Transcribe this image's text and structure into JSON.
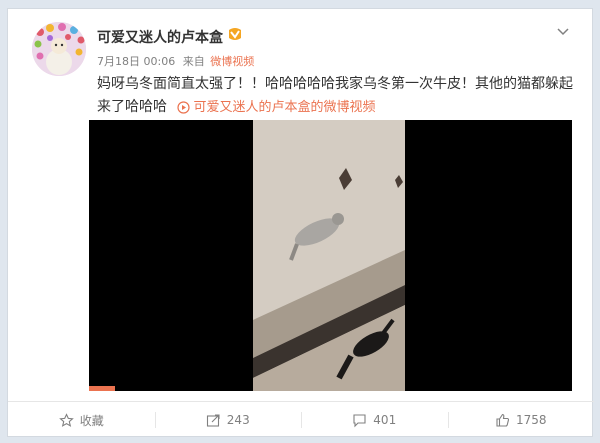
{
  "post": {
    "username": "可爱又迷人的卢本盒",
    "date": "7月18日 00:06",
    "source_prefix": "来自",
    "source_name": "微博视频",
    "text": "妈呀乌冬面简直太强了！！哈哈哈哈哈我家乌冬第一次牛皮！其他的猫都躲起来了哈哈哈",
    "video_link": "可爱又迷人的卢本盒的微博视频"
  },
  "actions": {
    "favorite_label": "收藏",
    "repost_count": "243",
    "comment_count": "401",
    "like_count": "1758"
  },
  "colors": {
    "accent": "#eb7350",
    "muted": "#808080"
  }
}
